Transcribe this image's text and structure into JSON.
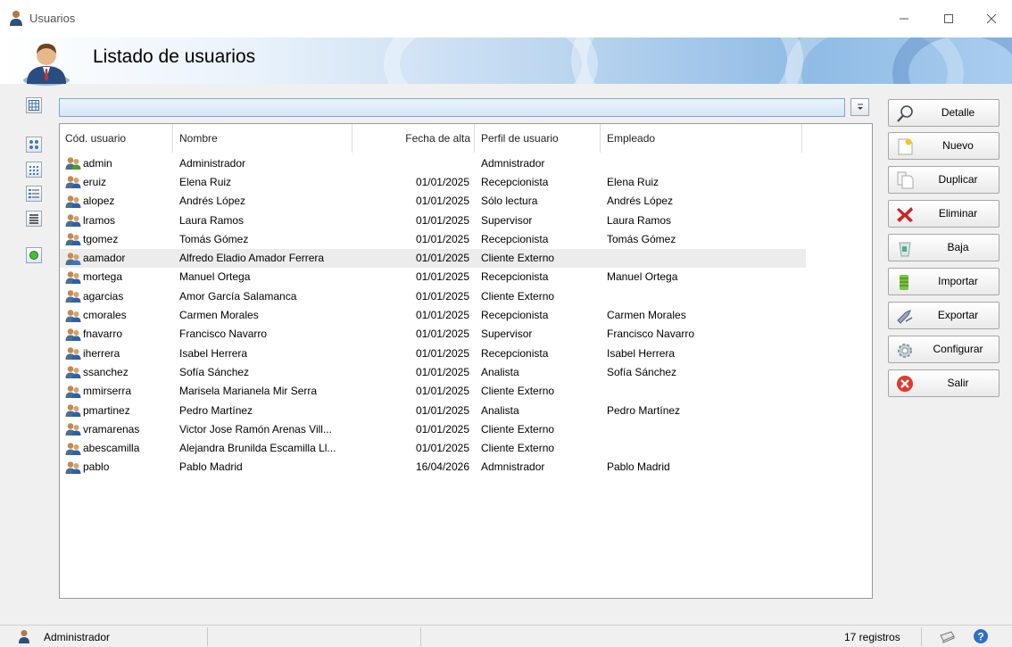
{
  "window": {
    "title": "Usuarios"
  },
  "header": {
    "title": "Listado de usuarios"
  },
  "grid": {
    "columns": [
      "Cód. usuario",
      "Nombre",
      "Fecha de alta",
      "Perfil de usuario",
      "Empleado"
    ],
    "rows": [
      {
        "code": "admin",
        "name": "Administrador",
        "date": "",
        "profile": "Admnistrador",
        "employee": "",
        "icon": "user-green-icon"
      },
      {
        "code": "eruiz",
        "name": "Elena Ruiz",
        "date": "01/01/2025",
        "profile": "Recepcionista",
        "employee": "Elena Ruiz",
        "icon": "user-icon"
      },
      {
        "code": "alopez",
        "name": "Andrés López",
        "date": "01/01/2025",
        "profile": "Sólo lectura",
        "employee": "Andrés López",
        "icon": "user-icon"
      },
      {
        "code": "lramos",
        "name": "Laura Ramos",
        "date": "01/01/2025",
        "profile": "Supervisor",
        "employee": "Laura Ramos",
        "icon": "user-icon"
      },
      {
        "code": "tgomez",
        "name": "Tomás Gómez",
        "date": "01/01/2025",
        "profile": "Recepcionista",
        "employee": "Tomás Gómez",
        "icon": "user-icon"
      },
      {
        "code": "aamador",
        "name": "Alfredo Eladio Amador Ferrera",
        "date": "01/01/2025",
        "profile": "Cliente Externo",
        "employee": "",
        "icon": "external-user-icon"
      },
      {
        "code": "mortega",
        "name": "Manuel Ortega",
        "date": "01/01/2025",
        "profile": "Recepcionista",
        "employee": "Manuel Ortega",
        "icon": "user-icon"
      },
      {
        "code": "agarcias",
        "name": "Amor García Salamanca",
        "date": "01/01/2025",
        "profile": "Cliente Externo",
        "employee": "",
        "icon": "user-icon"
      },
      {
        "code": "cmorales",
        "name": "Carmen Morales",
        "date": "01/01/2025",
        "profile": "Recepcionista",
        "employee": "Carmen Morales",
        "icon": "user-icon"
      },
      {
        "code": "fnavarro",
        "name": "Francisco Navarro",
        "date": "01/01/2025",
        "profile": "Supervisor",
        "employee": "Francisco Navarro",
        "icon": "user-icon"
      },
      {
        "code": "iherrera",
        "name": "Isabel Herrera",
        "date": "01/01/2025",
        "profile": "Recepcionista",
        "employee": "Isabel Herrera",
        "icon": "user-icon"
      },
      {
        "code": "ssanchez",
        "name": "Sofía Sánchez",
        "date": "01/01/2025",
        "profile": "Analista",
        "employee": "Sofía Sánchez",
        "icon": "user-icon"
      },
      {
        "code": "mmirserra",
        "name": "Marisela Marianela Mir Serra",
        "date": "01/01/2025",
        "profile": "Cliente Externo",
        "employee": "",
        "icon": "user-icon"
      },
      {
        "code": "pmartinez",
        "name": "Pedro Martínez",
        "date": "01/01/2025",
        "profile": "Analista",
        "employee": "Pedro Martínez",
        "icon": "user-icon"
      },
      {
        "code": "vramarenas",
        "name": "Victor Jose Ramón Arenas Vill...",
        "date": "01/01/2025",
        "profile": "Cliente Externo",
        "employee": "",
        "icon": "user-icon"
      },
      {
        "code": "abescamilla",
        "name": "Alejandra Brunilda Escamilla Ll...",
        "date": "01/01/2025",
        "profile": "Cliente Externo",
        "employee": "",
        "icon": "user-icon"
      },
      {
        "code": "pablo",
        "name": "Pablo Madrid",
        "date": "16/04/2026",
        "profile": "Admnistrador",
        "employee": "Pablo Madrid",
        "icon": "user-icon"
      }
    ],
    "selected_row": 5
  },
  "actions": [
    {
      "label": "Detalle",
      "icon": "magnifier-icon"
    },
    {
      "label": "Nuevo",
      "icon": "new-document-icon"
    },
    {
      "label": "Duplicar",
      "icon": "duplicate-icon"
    },
    {
      "label": "Eliminar",
      "icon": "delete-x-icon"
    },
    {
      "label": "Baja",
      "icon": "trash-bin-icon"
    },
    {
      "label": "Importar",
      "icon": "import-icon"
    },
    {
      "label": "Exportar",
      "icon": "export-icon"
    },
    {
      "label": "Configurar",
      "icon": "gear-icon"
    },
    {
      "label": "Salir",
      "icon": "exit-icon"
    }
  ],
  "statusbar": {
    "user": "Administrador",
    "count": "17 registros"
  },
  "colors": {
    "accent": "#8fbbe5",
    "filter_bar": "#d5e6f7",
    "selected_row": "#ececec",
    "exit_red": "#e0392b"
  }
}
